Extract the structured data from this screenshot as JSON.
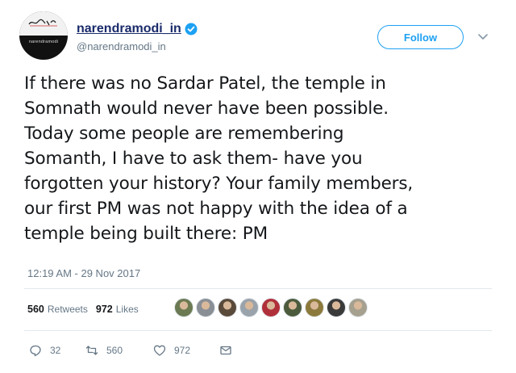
{
  "author": {
    "display_name": "narendramodi_in",
    "handle": "@narendramodi_in",
    "verified": true,
    "avatar_band_text": "narendramodi"
  },
  "follow_label": "Follow",
  "tweet_text": "If there was no Sardar Patel, the temple in\nSomnath would never have been possible.\nToday some people are remembering\nSomanth, I have to ask them- have you\nforgotten your history? Your family members,\nour first PM was not happy with the idea of a\ntemple being built there: PM",
  "timestamp": "12:19 AM - 29 Nov 2017",
  "stats": {
    "retweets_count": "560",
    "retweets_label": "Retweets",
    "likes_count": "972",
    "likes_label": "Likes"
  },
  "actions": {
    "reply_count": "32",
    "retweet_count": "560",
    "like_count": "972"
  },
  "colors": {
    "accent": "#1da1f2",
    "name": "#1a2b6b",
    "secondary_text": "#657786"
  },
  "liker_avatars": [
    "#6b7a52",
    "#8a8f96",
    "#5a4a3a",
    "#9aa3ab",
    "#b0303a",
    "#4c5b3c",
    "#8c7a3c",
    "#3a3a3a",
    "#a6a08f"
  ]
}
